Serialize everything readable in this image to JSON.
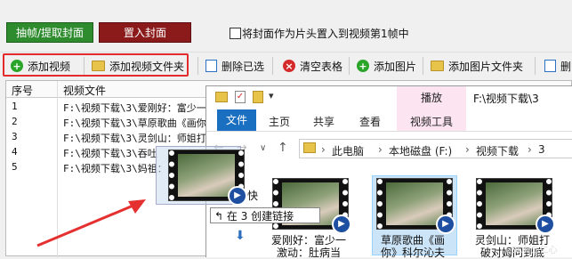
{
  "top": {
    "extract_cover_btn": "抽帧/提取封面",
    "place_cover_btn": "置入封面",
    "checkbox_label": "将封面作为片头置入到视频第1帧中"
  },
  "toolbar": {
    "add_video": "添加视频",
    "add_video_folder": "添加视频文件夹",
    "delete_selected": "删除已选",
    "clear_table": "清空表格",
    "add_image": "添加图片",
    "add_image_folder": "添加图片文件夹",
    "more": "删"
  },
  "grid": {
    "headers": [
      "序号",
      "视频文件"
    ],
    "rows": [
      {
        "n": "1",
        "path": "F:\\视频下载\\3\\爱刚好：富少一"
      },
      {
        "n": "2",
        "path": "F:\\视频下载\\3\\草原歌曲《画你"
      },
      {
        "n": "3",
        "path": "F:\\视频下载\\3\\灵剑山：师姐打"
      },
      {
        "n": "4",
        "path": "F:\\视频下载\\3\\吞吐"
      },
      {
        "n": "5",
        "path": "F:\\视频下载\\3\\妈祖："
      }
    ]
  },
  "explorer": {
    "title_path": "F:\\视频下载\\3",
    "tab_file": "文件",
    "tab_home": "主页",
    "tab_share": "共享",
    "tab_view": "查看",
    "tab_play": "播放",
    "tab_video_tools": "视频工具",
    "crumbs": [
      "此电脑",
      "本地磁盘 (F:)",
      "视频下载",
      "3"
    ],
    "quick_access_prefix": "快",
    "files": [
      {
        "caption": "爱刚好：富少一 激动：肚病当"
      },
      {
        "caption": "草原歌曲《画 你》科尔沁夫"
      },
      {
        "caption": "灵剑山：师姐打 破对姆问到底"
      }
    ]
  },
  "tooltip": "在 3 创建链接",
  "tooltip_icon": "link-arrow-icon",
  "watermark": "CSDN@仁心",
  "colors": {
    "green_btn": "#2e8b2e",
    "red_btn": "#8b1a1a",
    "highlight_box": "#e32b2b",
    "file_tab": "#1a6fc0",
    "play_tab": "#fce4f0"
  }
}
